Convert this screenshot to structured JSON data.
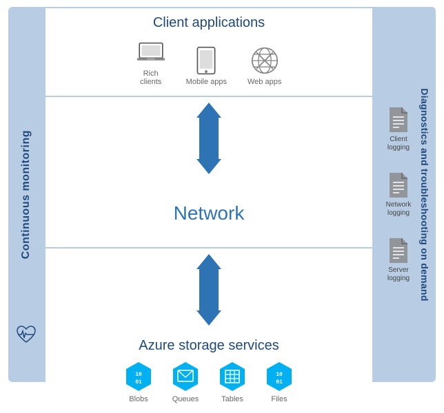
{
  "leftSidebar": {
    "text": "Continuous monitoring",
    "heartIcon": "♥"
  },
  "clientApps": {
    "title": "Client applications",
    "icons": [
      {
        "id": "rich-clients",
        "label": "Rich\nclients",
        "type": "laptop"
      },
      {
        "id": "mobile-apps",
        "label": "Mobile apps",
        "type": "tablet"
      },
      {
        "id": "web-apps",
        "label": "Web apps",
        "type": "globe"
      }
    ]
  },
  "network": {
    "title": "Network"
  },
  "azureStorage": {
    "title": "Azure storage services",
    "icons": [
      {
        "id": "blobs",
        "label": "Blobs",
        "type": "blobs",
        "color": "#00b0f0"
      },
      {
        "id": "queues",
        "label": "Queues",
        "type": "queues",
        "color": "#00b0f0"
      },
      {
        "id": "tables",
        "label": "Tables",
        "type": "tables",
        "color": "#00b0f0"
      },
      {
        "id": "files",
        "label": "Files",
        "type": "files",
        "color": "#00b0f0"
      }
    ]
  },
  "rightSidebar": {
    "text": "Diagnostics and troubleshooting on demand",
    "icons": [
      {
        "id": "client-logging",
        "label": "Client\nlogging"
      },
      {
        "id": "network-logging",
        "label": "Network\nlogging"
      },
      {
        "id": "server-logging",
        "label": "Server\nlogging"
      }
    ]
  },
  "colors": {
    "sidebarBg": "#b8cce4",
    "titleBlue": "#1f497d",
    "arrowBlue": "#2e74b5",
    "networkBlue": "#2e74b5",
    "iconCyan": "#00b0f0"
  }
}
